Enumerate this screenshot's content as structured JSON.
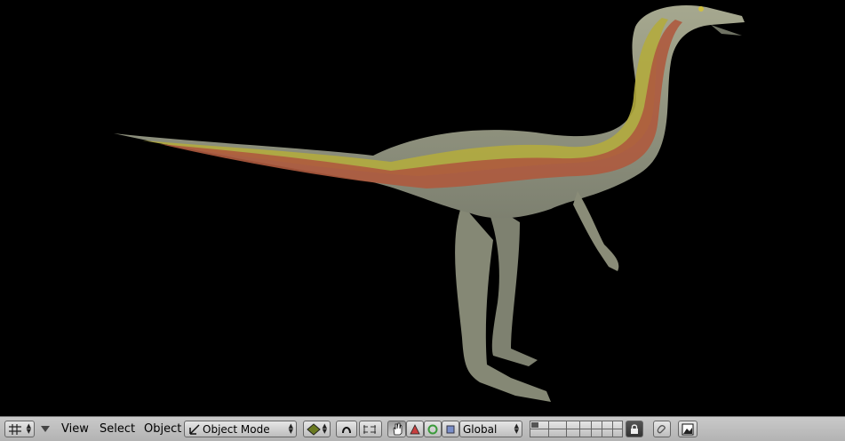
{
  "header": {
    "menus": {
      "view": "View",
      "select": "Select",
      "object": "Object"
    },
    "mode": {
      "label": "Object Mode"
    },
    "orientation": {
      "label": "Global"
    }
  },
  "icons": {
    "editor_type": "grid-icon",
    "collapse": "triangle-down-icon",
    "mode": "object-mode-icon",
    "shading": "solid-shading-icon",
    "pivot": "pivot-icon",
    "snap": "snap-icon",
    "manipulator": "hand-icon",
    "translate": "translate-icon",
    "rotate": "rotate-icon",
    "scale": "scale-icon",
    "lock": "lock-icon",
    "link": "link-icon",
    "render": "render-icon"
  },
  "colors": {
    "background": "#000000",
    "header": "#bcbcbc",
    "skin": "#9da08a",
    "stripe_red": "#b0563c",
    "stripe_yellow": "#b8ae3c"
  }
}
